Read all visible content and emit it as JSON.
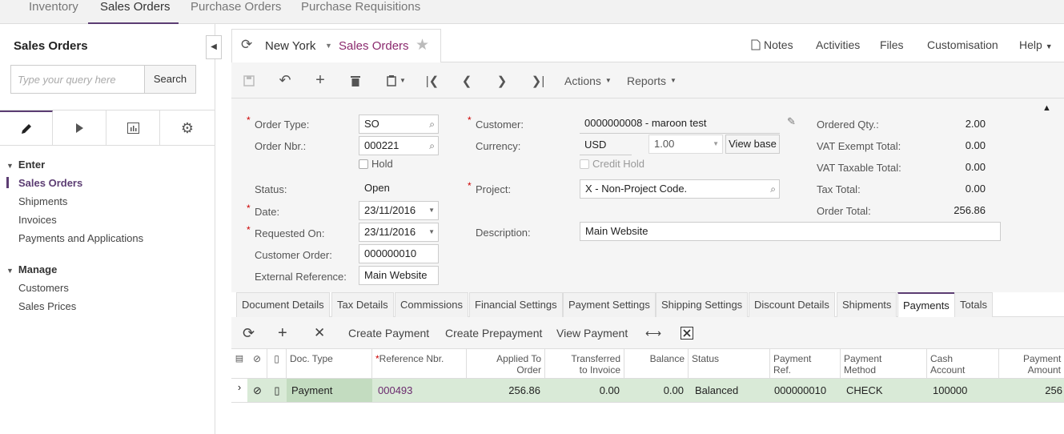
{
  "topnav": {
    "tabs": [
      "Inventory",
      "Sales Orders",
      "Purchase Orders",
      "Purchase Requisitions"
    ],
    "active": "Sales Orders"
  },
  "sidebar": {
    "title": "Sales Orders",
    "search_placeholder": "Type your query here",
    "search_button": "Search",
    "groups": [
      {
        "label": "Enter",
        "items": [
          "Sales Orders",
          "Shipments",
          "Invoices",
          "Payments and Applications"
        ]
      },
      {
        "label": "Manage",
        "items": [
          "Customers",
          "Sales Prices"
        ]
      }
    ],
    "active_item": "Sales Orders"
  },
  "header": {
    "branch": "New York",
    "screen": "Sales Orders",
    "right_links": [
      "Notes",
      "Activities",
      "Files",
      "Customisation",
      "Help"
    ]
  },
  "toolbar": {
    "actions": "Actions",
    "reports": "Reports"
  },
  "form": {
    "order_type": {
      "label": "Order Type:",
      "value": "SO"
    },
    "order_nbr": {
      "label": "Order Nbr.:",
      "value": "000221"
    },
    "hold": {
      "label": "Hold",
      "checked": false
    },
    "status": {
      "label": "Status:",
      "value": "Open"
    },
    "date": {
      "label": "Date:",
      "value": "23/11/2016"
    },
    "requested_on": {
      "label": "Requested On:",
      "value": "23/11/2016"
    },
    "customer_order": {
      "label": "Customer Order:",
      "value": "000000010"
    },
    "external_reference": {
      "label": "External Reference:",
      "value": "Main Website"
    },
    "customer": {
      "label": "Customer:",
      "value": "0000000008 - maroon test"
    },
    "currency": {
      "label": "Currency:",
      "value": "USD",
      "rate": "1.00",
      "view_base": "View base"
    },
    "credit_hold": {
      "label": "Credit Hold",
      "checked": false
    },
    "project": {
      "label": "Project:",
      "value": "X - Non-Project Code."
    },
    "description": {
      "label": "Description:",
      "value": "Main Website"
    },
    "totals": [
      {
        "label": "Ordered Qty.:",
        "value": "2.00"
      },
      {
        "label": "VAT Exempt Total:",
        "value": "0.00"
      },
      {
        "label": "VAT Taxable Total:",
        "value": "0.00"
      },
      {
        "label": "Tax Total:",
        "value": "0.00"
      },
      {
        "label": "Order Total:",
        "value": "256.86"
      }
    ]
  },
  "tabs": [
    "Document Details",
    "Tax Details",
    "Commissions",
    "Financial Settings",
    "Payment Settings",
    "Shipping Settings",
    "Discount Details",
    "Shipments",
    "Payments",
    "Totals"
  ],
  "active_tab": "Payments",
  "grid_toolbar": {
    "create_payment": "Create Payment",
    "create_prepayment": "Create Prepayment",
    "view_payment": "View Payment"
  },
  "grid": {
    "columns": [
      "Doc. Type",
      "Reference Nbr.",
      "Applied To Order",
      "Transferred to Invoice",
      "Balance",
      "Status",
      "Payment Ref.",
      "Payment Method",
      "Cash Account",
      "Payment Amount"
    ],
    "rows": [
      {
        "doc_type": "Payment",
        "ref_nbr": "000493",
        "applied": "256.86",
        "transferred": "0.00",
        "balance": "0.00",
        "status": "Balanced",
        "payment_ref": "000000010",
        "method": "CHECK",
        "cash_account": "100000",
        "amount": "256"
      }
    ]
  }
}
